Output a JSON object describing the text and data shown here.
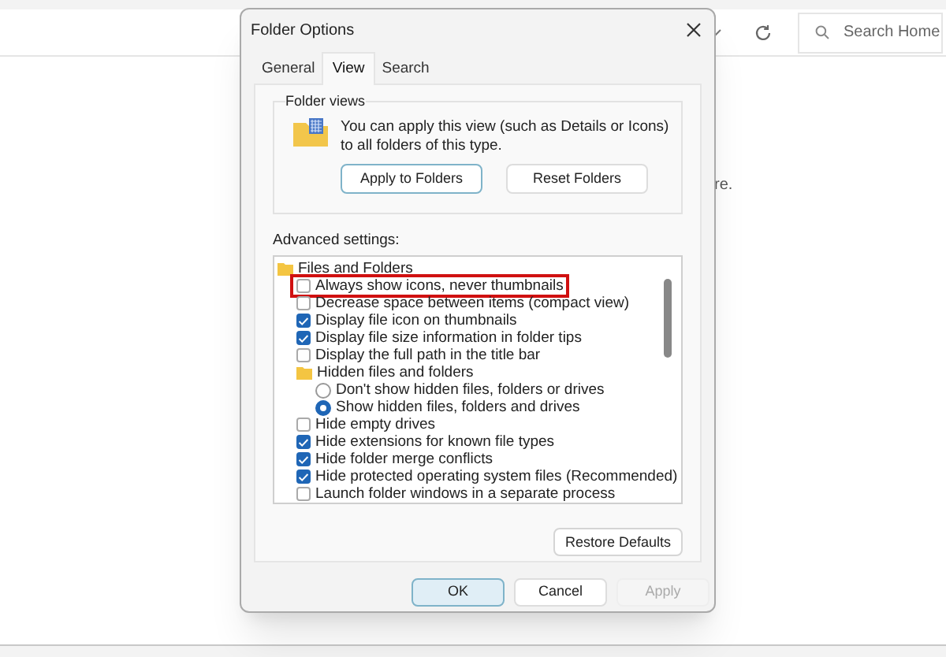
{
  "explorer": {
    "search": {
      "placeholder": "Search Home"
    },
    "body_text": "re."
  },
  "dialog": {
    "title": "Folder Options",
    "tabs": [
      {
        "label": "General",
        "selected": false
      },
      {
        "label": "View",
        "selected": true
      },
      {
        "label": "Search",
        "selected": false
      }
    ],
    "folder_views": {
      "heading": "Folder views",
      "description": "You can apply this view (such as Details or Icons) to all folders of this type.",
      "buttons": [
        "Apply to Folders",
        "Reset Folders"
      ]
    },
    "advanced": {
      "label": "Advanced settings:",
      "items": [
        {
          "kind": "group",
          "label": "Files and Folders",
          "children": [
            {
              "kind": "checkbox",
              "label": "Always show icons, never thumbnails",
              "checked": false,
              "highlighted": true
            },
            {
              "kind": "checkbox",
              "label": "Decrease space between items (compact view)",
              "checked": false,
              "highlighted": false
            },
            {
              "kind": "checkbox",
              "label": "Display file icon on thumbnails",
              "checked": true,
              "highlighted": false
            },
            {
              "kind": "checkbox",
              "label": "Display file size information in folder tips",
              "checked": true,
              "highlighted": false
            },
            {
              "kind": "checkbox",
              "label": "Display the full path in the title bar",
              "checked": false,
              "highlighted": false
            },
            {
              "kind": "group",
              "label": "Hidden files and folders",
              "children": [
                {
                  "kind": "radio",
                  "label": "Don't show hidden files, folders or drives",
                  "selected": false
                },
                {
                  "kind": "radio",
                  "label": "Show hidden files, folders and drives",
                  "selected": true
                }
              ]
            },
            {
              "kind": "checkbox",
              "label": "Hide empty drives",
              "checked": false,
              "highlighted": false
            },
            {
              "kind": "checkbox",
              "label": "Hide extensions for known file types",
              "checked": true,
              "highlighted": false
            },
            {
              "kind": "checkbox",
              "label": "Hide folder merge conflicts",
              "checked": true,
              "highlighted": false
            },
            {
              "kind": "checkbox",
              "label": "Hide protected operating system files (Recommended)",
              "checked": true,
              "highlighted": false
            },
            {
              "kind": "checkbox",
              "label": "Launch folder windows in a separate process",
              "checked": false,
              "highlighted": false
            }
          ]
        }
      ]
    },
    "restore_button": "Restore Defaults",
    "footer_buttons": [
      {
        "label": "OK",
        "kind": "default",
        "disabled": false
      },
      {
        "label": "Cancel",
        "kind": "normal",
        "disabled": false
      },
      {
        "label": "Apply",
        "kind": "normal",
        "disabled": true
      }
    ]
  }
}
